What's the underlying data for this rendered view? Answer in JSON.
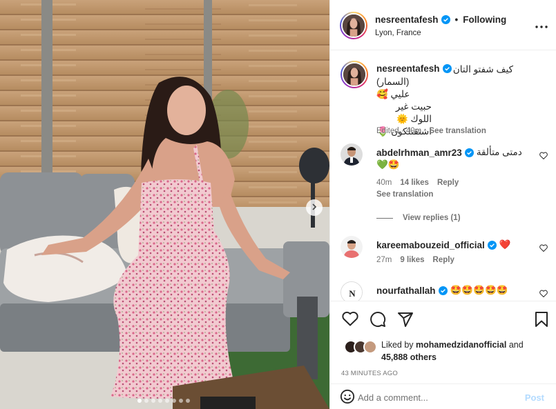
{
  "post": {
    "author": "nesreentafesh",
    "follow_status": "Following",
    "separator": "•",
    "location": "Lyon, France",
    "caption_lines": [
      "كيف شفتو التان",
      "(السمار) عليي 🥰",
      "حبيت غير اللوك 🌞",
      "اشتقتلكون 🌷"
    ],
    "caption_edited": "Edited · 40m",
    "see_translation": "See translation",
    "likes_by": "mohamedzidanofficial",
    "liked_prefix": "Liked by",
    "liked_and": "and",
    "likes_others": "45,888 others",
    "timestamp": "43 MINUTES AGO"
  },
  "comments": [
    {
      "user": "abdelrhman_amr23",
      "text": "دمتى متألقة",
      "text2": "💚🤩",
      "time": "40m",
      "likes": "14 likes",
      "reply": "Reply",
      "see_translation": "See translation",
      "view_replies": "View replies (1)"
    },
    {
      "user": "kareemabouzeid_official",
      "text": "❤️",
      "time": "27m",
      "likes": "9 likes",
      "reply": "Reply"
    },
    {
      "user": "nourfathallah",
      "text": "🤩🤩🤩🤩🤩"
    }
  ],
  "composer": {
    "placeholder": "Add a comment...",
    "post_label": "Post"
  },
  "carousel": {
    "slides": 8,
    "active": 0
  },
  "icons": [
    "verified-icon",
    "more-options-icon",
    "heart-icon",
    "comment-icon",
    "share-icon",
    "bookmark-icon",
    "emoji-icon",
    "chevron-right-icon"
  ],
  "colors": {
    "verified": "#0095f6",
    "post_disabled": "#b3dbff",
    "meta_text": "#737373"
  }
}
